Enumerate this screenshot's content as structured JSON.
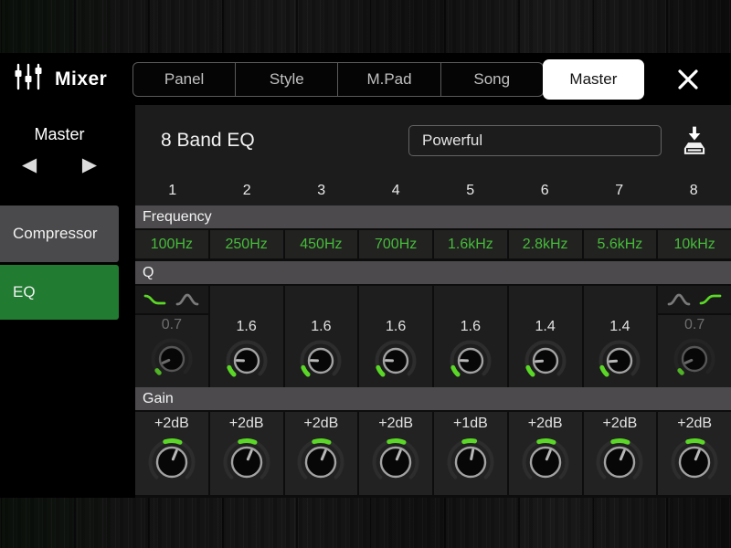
{
  "window": {
    "title": "Mixer",
    "close_icon": "✕"
  },
  "tabs": [
    {
      "label": "Panel",
      "active": false
    },
    {
      "label": "Style",
      "active": false
    },
    {
      "label": "M.Pad",
      "active": false
    },
    {
      "label": "Song",
      "active": false
    },
    {
      "label": "Master",
      "active": true
    }
  ],
  "sidebar": {
    "part_label": "Master",
    "prev_icon": "◀",
    "next_icon": "▶",
    "items": [
      {
        "label": "Compressor",
        "active": false
      },
      {
        "label": "EQ",
        "active": true
      }
    ]
  },
  "eq": {
    "title": "8 Band EQ",
    "preset_value": "Powerful",
    "save_icon": "save-to-storage",
    "row_labels": {
      "frequency": "Frequency",
      "q": "Q",
      "gain": "Gain"
    },
    "bands": [
      {
        "number": "1",
        "frequency": "100Hz",
        "q": "0.7",
        "q_enabled": false,
        "shape_selector": {
          "order": [
            "shelf",
            "peak"
          ],
          "selected": "shelf",
          "shelf_direction": "low"
        },
        "gain": "+2dB"
      },
      {
        "number": "2",
        "frequency": "250Hz",
        "q": "1.6",
        "q_enabled": true,
        "gain": "+2dB"
      },
      {
        "number": "3",
        "frequency": "450Hz",
        "q": "1.6",
        "q_enabled": true,
        "gain": "+2dB"
      },
      {
        "number": "4",
        "frequency": "700Hz",
        "q": "1.6",
        "q_enabled": true,
        "gain": "+2dB"
      },
      {
        "number": "5",
        "frequency": "1.6kHz",
        "q": "1.6",
        "q_enabled": true,
        "gain": "+1dB"
      },
      {
        "number": "6",
        "frequency": "2.8kHz",
        "q": "1.4",
        "q_enabled": true,
        "gain": "+2dB"
      },
      {
        "number": "7",
        "frequency": "5.6kHz",
        "q": "1.4",
        "q_enabled": true,
        "gain": "+2dB"
      },
      {
        "number": "8",
        "frequency": "10kHz",
        "q": "0.7",
        "q_enabled": false,
        "shape_selector": {
          "order": [
            "peak",
            "shelf"
          ],
          "selected": "shelf",
          "shelf_direction": "high"
        },
        "gain": "+2dB"
      }
    ]
  },
  "icons": {
    "mixer": "fader-sliders",
    "shelf_low": "falling-shelf-curve",
    "peak": "bell-curve",
    "shelf_high": "rising-shelf-curve"
  },
  "colors": {
    "accent_green": "#217c31",
    "value_green": "#46bc3a",
    "knob_green": "#5bd827",
    "section_bar": "#4c4a4d",
    "tab_active_bg": "#ffffff"
  }
}
